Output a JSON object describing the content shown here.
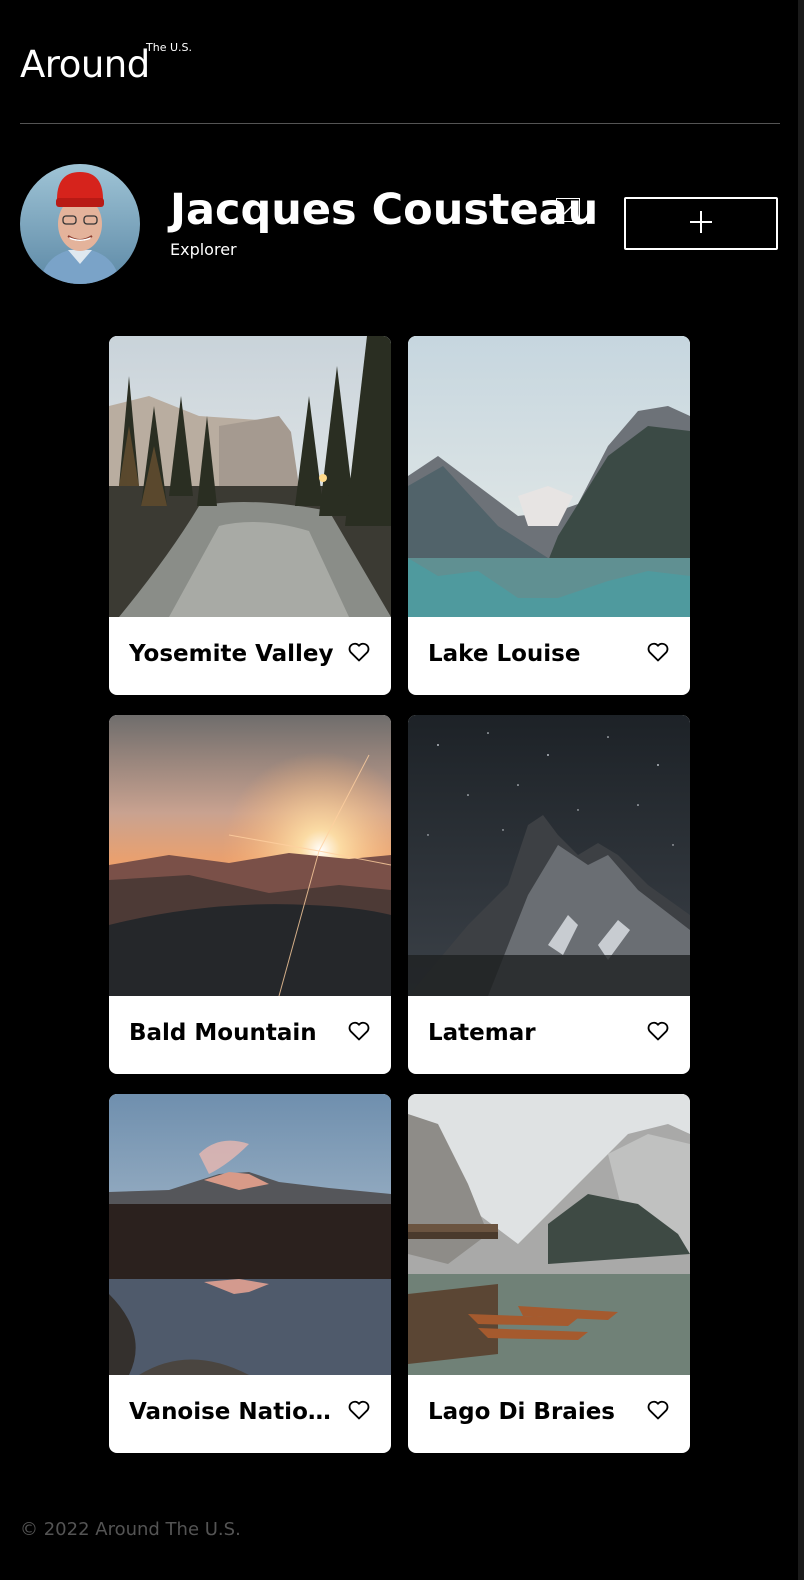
{
  "header": {
    "logo": "Around",
    "logo_superscript": "The U.S."
  },
  "profile": {
    "name": "Jacques Cousteau",
    "about": "Explorer",
    "avatar_icon": "avatar-photo",
    "edit_icon": "pencil-icon",
    "add_icon": "plus-icon"
  },
  "cards": [
    {
      "title": "Yosemite Valley",
      "icon": "heart-outline-icon"
    },
    {
      "title": "Lake Louise",
      "icon": "heart-outline-icon"
    },
    {
      "title": "Bald Mountain",
      "icon": "heart-outline-icon"
    },
    {
      "title": "Latemar",
      "icon": "heart-outline-icon"
    },
    {
      "title": "Vanoise National Park",
      "icon": "heart-outline-icon"
    },
    {
      "title": "Lago Di Braies",
      "icon": "heart-outline-icon"
    }
  ],
  "footer": {
    "text": "© 2022 Around The U.S."
  },
  "colors": {
    "background": "#000000",
    "card": "#ffffff",
    "divider": "#545454",
    "footer_text": "#545454"
  }
}
